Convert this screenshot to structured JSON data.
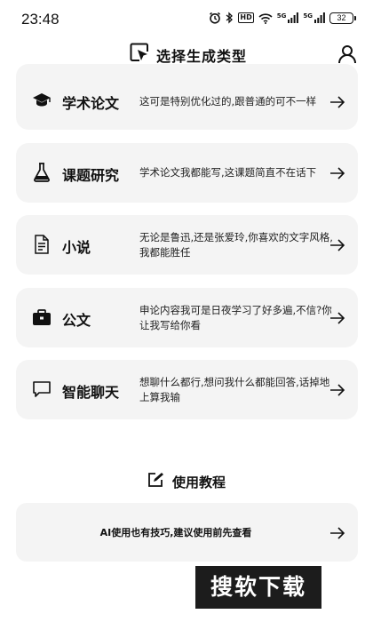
{
  "status_bar": {
    "time": "23:48",
    "hd_label": "HD",
    "signal1_label": "5G",
    "signal2_label": "5G",
    "battery": "32",
    "icons": [
      "alarm-icon",
      "bluetooth-icon",
      "wifi-icon",
      "signal-icon",
      "battery-icon"
    ]
  },
  "header": {
    "title": "选择生成类型",
    "icon": "cursor-select-icon",
    "profile_icon": "person-icon"
  },
  "cards": [
    {
      "title": "学术论文",
      "desc": "这可是特别优化过的,跟普通的可不一样",
      "icon": "graduation-cap-icon"
    },
    {
      "title": "课题研究",
      "desc": "学术论文我都能写,这课题简直不在话下",
      "icon": "flask-icon"
    },
    {
      "title": "小说",
      "desc": "无论是鲁迅,还是张爱玲,你喜欢的文字风格,我都能胜任",
      "icon": "document-icon"
    },
    {
      "title": "公文",
      "desc": "申论内容我可是日夜学习了好多遍,不信?你让我写给你看",
      "icon": "briefcase-icon"
    },
    {
      "title": "智能聊天",
      "desc": "想聊什么都行,想问我什么都能回答,话掉地上算我输",
      "icon": "chat-bubble-icon"
    }
  ],
  "tutorial": {
    "title": "使用教程",
    "icon": "edit-icon",
    "link_text": "AI使用也有技巧,建议使用前先查看"
  },
  "watermark": "搜软下载",
  "colors": {
    "card_bg": "#f4f4f4",
    "text": "#111111",
    "watermark_bg": "#1c1c1c"
  }
}
